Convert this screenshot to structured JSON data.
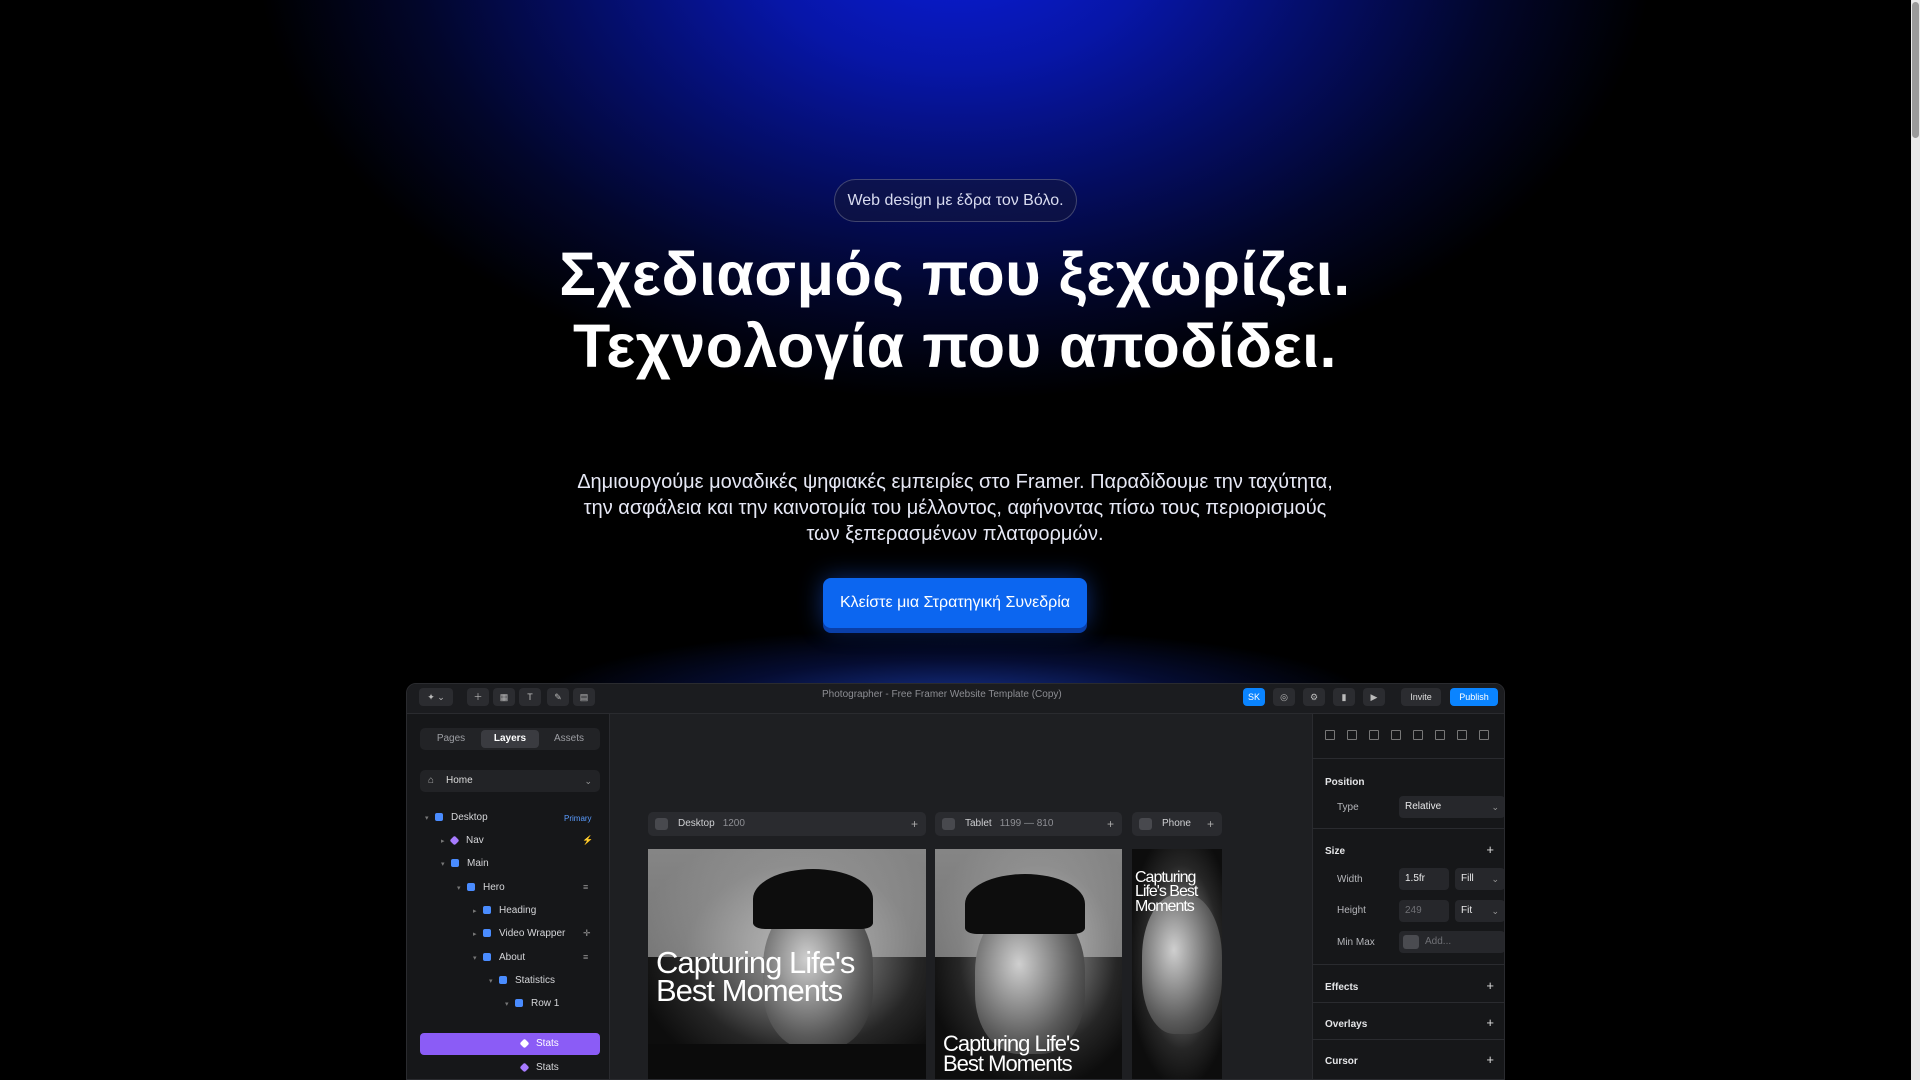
{
  "colors": {
    "accent_blue": "#0c66f0",
    "background_top": "#0716a8",
    "background_base": "#000000",
    "layer_selected": "#8b5cf6",
    "publish_blue": "#0a84ff"
  },
  "hero": {
    "pill_text": "Web design με έδρα τον Βόλο.",
    "title": "Σχεδιασμός που ξεχωρίζει. Τεχνολογία που αποδίδει.",
    "description": "Δημιουργούμε μοναδικές ψηφιακές εμπειρίες στο Framer. Παραδίδουμε την ταχύτητα, την ασφάλεια και την καινοτομία του μέλλοντος, αφήνοντας πίσω τους περιορισμούς των ξεπερασμένων πλατφορμών.",
    "cta_label": "Κλείστε μια Στρατηγική Συνεδρία"
  },
  "framer": {
    "topbar": {
      "title": "Photographer - Free Framer Website Template (Copy)",
      "invite_label": "Invite",
      "publish_label": "Publish"
    },
    "sidebar": {
      "tabs": [
        "Pages",
        "Layers",
        "Assets"
      ],
      "active_tab": "Layers",
      "page_select": "Home",
      "layers": [
        {
          "label": "Desktop",
          "badge": "Primary",
          "kind": "frame"
        },
        {
          "label": "Nav",
          "badge": "",
          "kind": "component"
        },
        {
          "label": "Main",
          "badge": "",
          "kind": "frame"
        },
        {
          "label": "Hero",
          "badge": "",
          "kind": "frame"
        },
        {
          "label": "Heading",
          "badge": "",
          "kind": "frame"
        },
        {
          "label": "Video Wrapper",
          "badge": "",
          "kind": "frame"
        },
        {
          "label": "About",
          "badge": "",
          "kind": "frame"
        },
        {
          "label": "Statistics",
          "badge": "",
          "kind": "frame"
        },
        {
          "label": "Row 1",
          "badge": "",
          "kind": "frame"
        },
        {
          "label": "Stats",
          "badge": "",
          "kind": "component",
          "selected": true
        },
        {
          "label": "Stats",
          "badge": "",
          "kind": "component"
        }
      ]
    },
    "canvas": {
      "breakpoints": [
        {
          "name": "Desktop",
          "size": "1200"
        },
        {
          "name": "Tablet",
          "size": "1199 — 810"
        },
        {
          "name": "Phone",
          "size": ""
        }
      ],
      "hero_caption": "Capturing Life's Best Moments"
    },
    "properties": {
      "position_label": "Position",
      "type_label": "Type",
      "type_value": "Relative",
      "size_label": "Size",
      "width_label": "Width",
      "width_value": "1.5fr",
      "width_mode": "Fill",
      "height_label": "Height",
      "height_value": "249",
      "height_mode": "Fit",
      "minmax_label": "Min Max",
      "minmax_placeholder": "Add...",
      "effects_label": "Effects",
      "overlays_label": "Overlays",
      "cursor_label": "Cursor"
    }
  }
}
